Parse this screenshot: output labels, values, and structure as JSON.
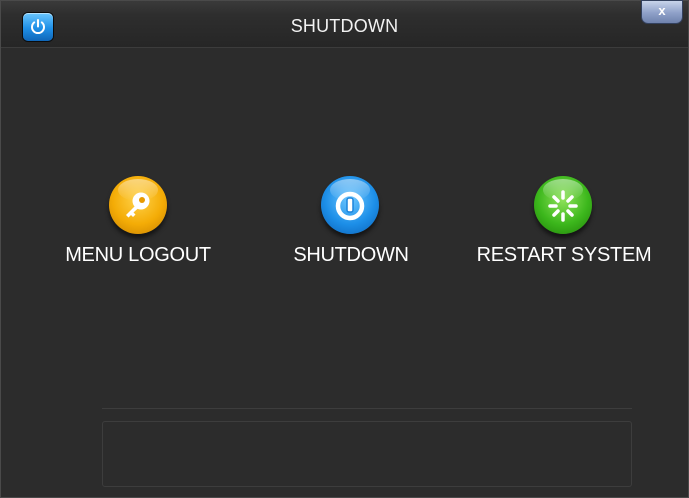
{
  "window": {
    "title": "SHUTDOWN",
    "close_label": "x",
    "app_icon": "power-icon"
  },
  "options": [
    {
      "label": "MENU LOGOUT",
      "icon": "key-icon",
      "color": "#f2a400"
    },
    {
      "label": "SHUTDOWN",
      "icon": "power-icon",
      "color": "#1b8ee8"
    },
    {
      "label": "RESTART SYSTEM",
      "icon": "spinner-icon",
      "color": "#3cb71c"
    }
  ],
  "status": {
    "message": ""
  },
  "colors": {
    "background": "#2c2c2c",
    "titlebar": "#262626",
    "text": "#ffffff"
  }
}
